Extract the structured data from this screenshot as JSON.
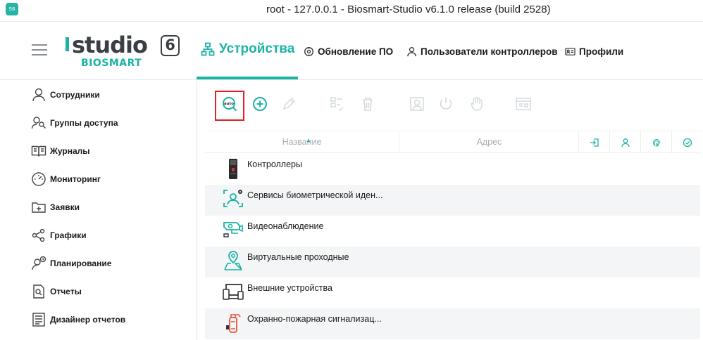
{
  "window": {
    "title": "root - 127.0.0.1 - Biosmart-Studio v6.1.0 release (build 2528)",
    "app_icon_text": "S6"
  },
  "logo": {
    "main": "studio",
    "version": "6",
    "sub": "BIOSMART"
  },
  "nav": {
    "devices": "Устройства",
    "update": "Обновление ПО",
    "users": "Пользователи контроллеров",
    "profiles": "Профили"
  },
  "sidebar": {
    "items": [
      {
        "label": "Сотрудники",
        "icon": "person-icon"
      },
      {
        "label": "Группы доступа",
        "icon": "group-icon"
      },
      {
        "label": "Журналы",
        "icon": "book-icon"
      },
      {
        "label": "Мониторинг",
        "icon": "gauge-icon"
      },
      {
        "label": "Заявки",
        "icon": "folder-plus-icon"
      },
      {
        "label": "Графики",
        "icon": "share-icon"
      },
      {
        "label": "Планирование",
        "icon": "person-clock-icon"
      },
      {
        "label": "Отчеты",
        "icon": "report-icon"
      },
      {
        "label": "Дизайнер отчетов",
        "icon": "designer-icon"
      }
    ]
  },
  "toolbar": {
    "auto_label": "auto"
  },
  "table": {
    "columns": {
      "name": "Название",
      "address": "Адрес"
    },
    "rows": [
      {
        "label": "Контроллеры",
        "icon": "controller-icon"
      },
      {
        "label": "Сервисы биометрической иден...",
        "icon": "face-scan-icon"
      },
      {
        "label": "Видеонаблюдение",
        "icon": "camera-icon"
      },
      {
        "label": "Виртуальные проходные",
        "icon": "map-pin-icon"
      },
      {
        "label": "Внешние устройства",
        "icon": "devices-icon"
      },
      {
        "label": "Охранно-пожарная сигнализац...",
        "icon": "extinguisher-icon"
      }
    ]
  },
  "colors": {
    "accent": "#1ab3a4",
    "highlight": "#e21f26",
    "text": "#1a1a1a"
  }
}
